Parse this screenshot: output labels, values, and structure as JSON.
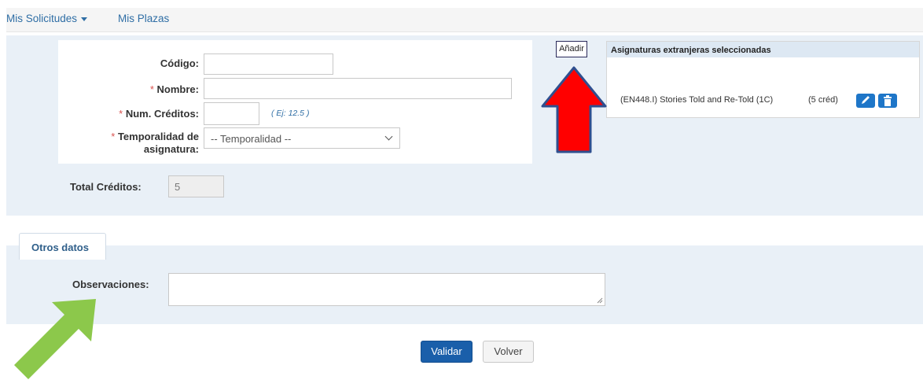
{
  "nav": {
    "items": [
      {
        "label": "Mis Solicitudes",
        "has_dropdown": true
      },
      {
        "label": "Mis Plazas",
        "has_dropdown": false
      }
    ]
  },
  "form": {
    "codigo": {
      "label": "Código:",
      "value": "",
      "required": false
    },
    "nombre": {
      "label": "Nombre:",
      "value": "",
      "required": true
    },
    "creditos": {
      "label": "Num. Créditos:",
      "value": "",
      "required": true,
      "hint": "( Ej: 12.5 )"
    },
    "temporalidad": {
      "label_line1": "Temporalidad de",
      "label_line2": "asignatura:",
      "required": true,
      "selected": "-- Temporalidad --"
    },
    "required_mark": "*"
  },
  "add_button": {
    "label": "Añadir"
  },
  "selected_panel": {
    "title": "Asignaturas extranjeras seleccionadas",
    "items": [
      {
        "name": "(EN448.I) Stories Told and Re-Told (1C)",
        "credits": "(5 créd)"
      }
    ]
  },
  "total": {
    "label": "Total Créditos:",
    "value": "5"
  },
  "otros": {
    "tab_label": "Otros datos",
    "observaciones_label": "Observaciones:",
    "observaciones_value": ""
  },
  "actions": {
    "validar": "Validar",
    "volver": "Volver"
  },
  "annotations": {
    "red_arrow_color": "#ff0000",
    "red_arrow_outline": "#2f4f8f",
    "green_arrow_color": "#8cc84b"
  },
  "colors": {
    "link": "#2f6ea5",
    "panel_bg": "#e9f0f7",
    "primary_button": "#1a5faa",
    "icon_button": "#1e76c8",
    "required": "#d9534f"
  }
}
